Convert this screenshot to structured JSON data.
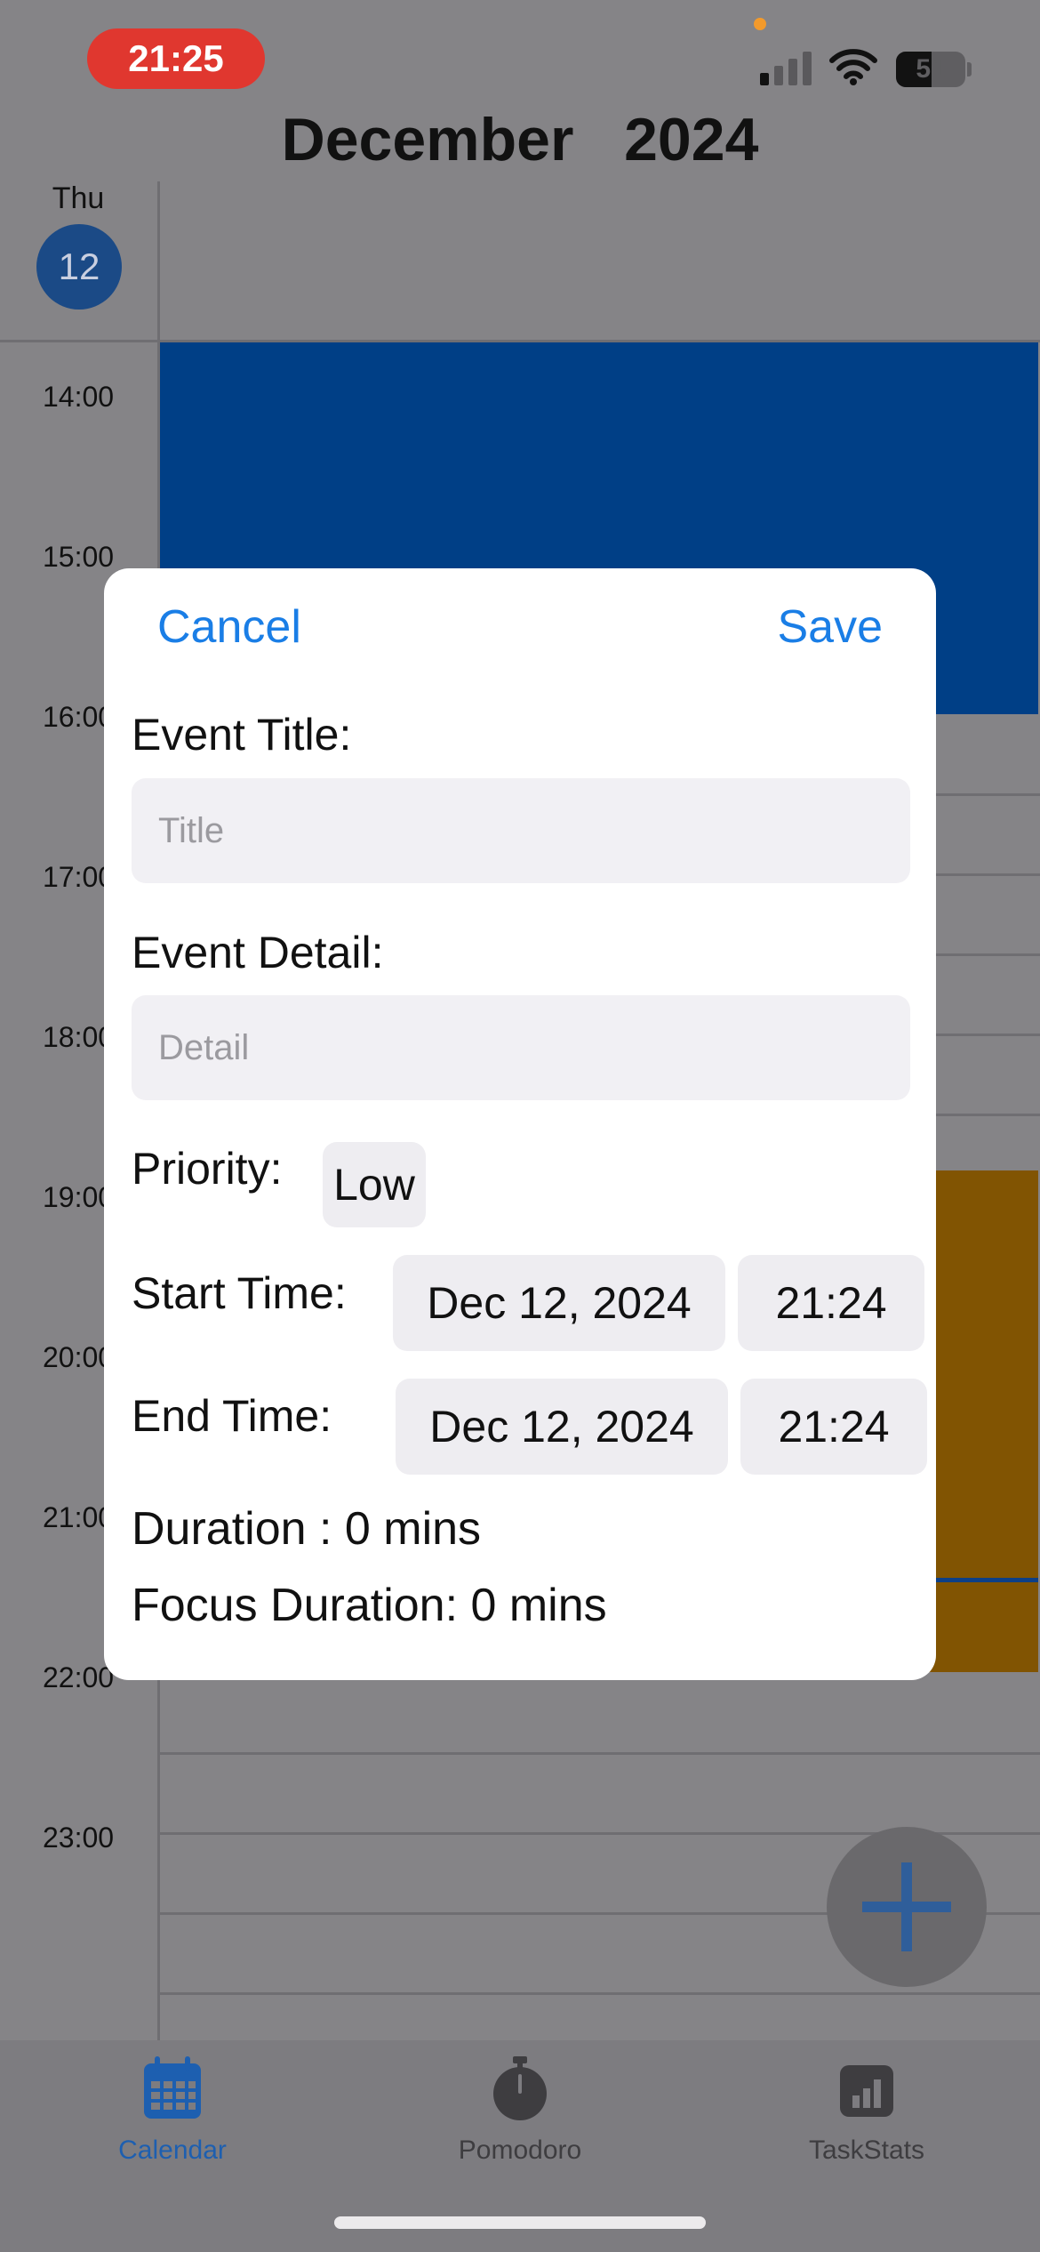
{
  "status_bar": {
    "time": "21:25",
    "battery": "51"
  },
  "calendar": {
    "month_title": "December   2024",
    "day_name": "Thu",
    "day_number": "12",
    "hours": [
      "14:00",
      "15:00",
      "16:00",
      "17:00",
      "18:00",
      "19:00",
      "20:00",
      "21:00",
      "22:00",
      "23:00"
    ]
  },
  "modal": {
    "cancel_label": "Cancel",
    "save_label": "Save",
    "event_title_label": "Event Title:",
    "event_title_placeholder": "Title",
    "event_detail_label": "Event Detail:",
    "event_detail_placeholder": "Detail",
    "priority_label": "Priority:",
    "priority_value": "Low",
    "start_time_label": "Start Time:",
    "start_date": "Dec 12, 2024",
    "start_time": "21:24",
    "end_time_label": "End Time:",
    "end_date": "Dec 12, 2024",
    "end_time": "21:24",
    "duration": "Duration : 0 mins",
    "focus_duration": "Focus Duration: 0 mins"
  },
  "tab_bar": {
    "items": [
      {
        "label": "Calendar",
        "icon": "calendar-icon",
        "active": true
      },
      {
        "label": "Pomodoro",
        "icon": "stopwatch-icon",
        "active": false
      },
      {
        "label": "TaskStats",
        "icon": "chart-icon",
        "active": false
      }
    ]
  },
  "colors": {
    "accent": "#1a7ee6",
    "event_blue": "#003f86",
    "event_orange": "#815402",
    "status_pill": "#e0372f"
  }
}
